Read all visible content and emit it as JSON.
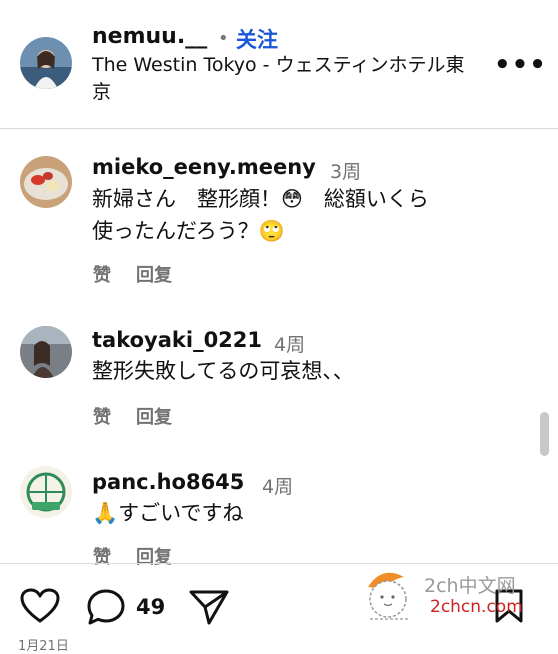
{
  "post": {
    "username": "nemuu.__",
    "separator": "•",
    "follow_label": "关注",
    "location": "The Westin Tokyo - ウェスティンホテル東京",
    "more_label": "•••"
  },
  "comments": [
    {
      "username": "mieko_eeny.meeny",
      "time": "3周",
      "line1": "新婦さん　整形顔！😳　総額いくら",
      "line2": "使ったんだろう？🙄",
      "like_label": "赞",
      "reply_label": "回复"
    },
    {
      "username": "takoyaki_0221",
      "time": "4周",
      "line1": "整形失敗してるの可哀想、、",
      "line2": "",
      "like_label": "赞",
      "reply_label": "回复"
    },
    {
      "username": "panc.ho8645",
      "time": "4周",
      "line1": "🙏すごいですね",
      "line2": "",
      "like_label": "赞",
      "reply_label": "回复"
    }
  ],
  "footer": {
    "comment_count": "49",
    "date_peek": "1月21日"
  },
  "watermark": {
    "line1": "2ch中文网",
    "line2": "2chcn.com"
  },
  "icons": {
    "like": "heart-icon",
    "comment": "comment-icon",
    "share": "send-icon",
    "save": "bookmark-icon"
  },
  "colors": {
    "follow": "#1a56db",
    "muted": "#737373",
    "divider": "#dbdbdb"
  }
}
